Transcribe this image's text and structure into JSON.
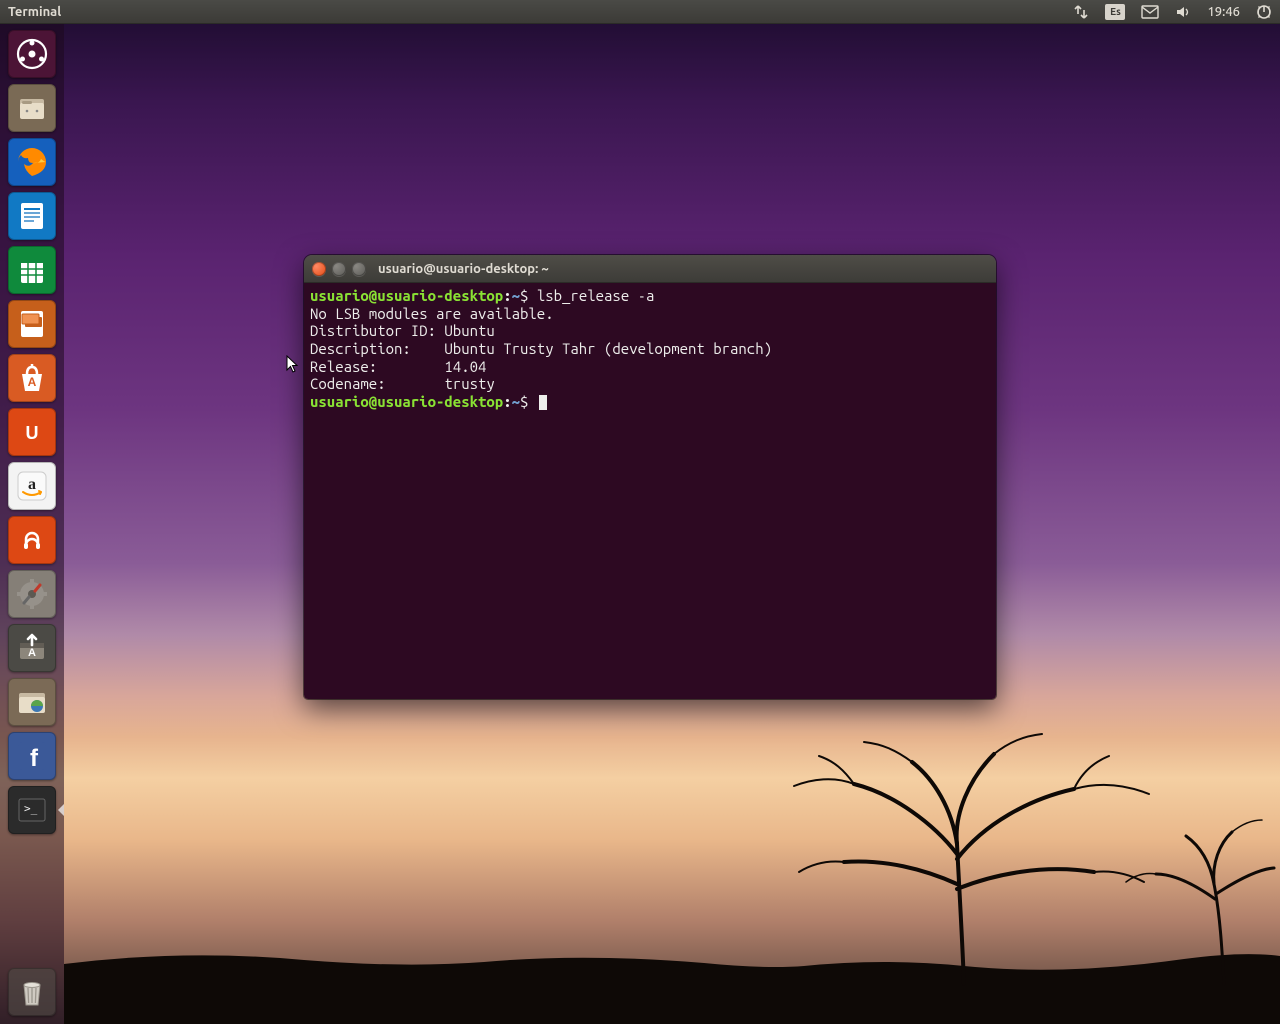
{
  "top_panel": {
    "app_title": "Terminal",
    "keyboard_layout": "Es",
    "clock": "19:46"
  },
  "launcher": {
    "items": [
      {
        "id": "dash",
        "name": "dash-home",
        "bg": "#4c1436"
      },
      {
        "id": "files",
        "name": "files",
        "bg": "#7a6a55"
      },
      {
        "id": "firefox",
        "name": "firefox",
        "bg": "#1560bd"
      },
      {
        "id": "writer",
        "name": "libreoffice-writer",
        "bg": "#1179c4"
      },
      {
        "id": "calc",
        "name": "libreoffice-calc",
        "bg": "#0f8a3c"
      },
      {
        "id": "impress",
        "name": "libreoffice-impress",
        "bg": "#c65f1b"
      },
      {
        "id": "software",
        "name": "software-center",
        "bg": "#d95b23"
      },
      {
        "id": "ubuntuone",
        "name": "ubuntu-one",
        "bg": "#dd4814"
      },
      {
        "id": "amazon",
        "name": "amazon",
        "bg": "#f3f3f3"
      },
      {
        "id": "music",
        "name": "ubuntu-music",
        "bg": "#dd4814"
      },
      {
        "id": "settings",
        "name": "system-settings",
        "bg": "#857f77"
      },
      {
        "id": "updater",
        "name": "software-updater",
        "bg": "#4b4a45"
      },
      {
        "id": "remote",
        "name": "remote-desktop",
        "bg": "#7b6a56"
      },
      {
        "id": "facebook",
        "name": "facebook",
        "bg": "#3b5998"
      },
      {
        "id": "terminal",
        "name": "terminal",
        "bg": "#2b2b2b",
        "active": true
      }
    ],
    "trash": {
      "name": "trash",
      "bg": "#555"
    }
  },
  "terminal": {
    "title": "usuario@usuario-desktop: ~",
    "prompt_user": "usuario@usuario-desktop",
    "prompt_path": "~",
    "command1": "lsb_release -a",
    "output": {
      "l1": "No LSB modules are available.",
      "l2": "Distributor ID: Ubuntu",
      "l3": "Description:    Ubuntu Trusty Tahr (development branch)",
      "l4": "Release:        14.04",
      "l5": "Codename:       trusty"
    }
  }
}
